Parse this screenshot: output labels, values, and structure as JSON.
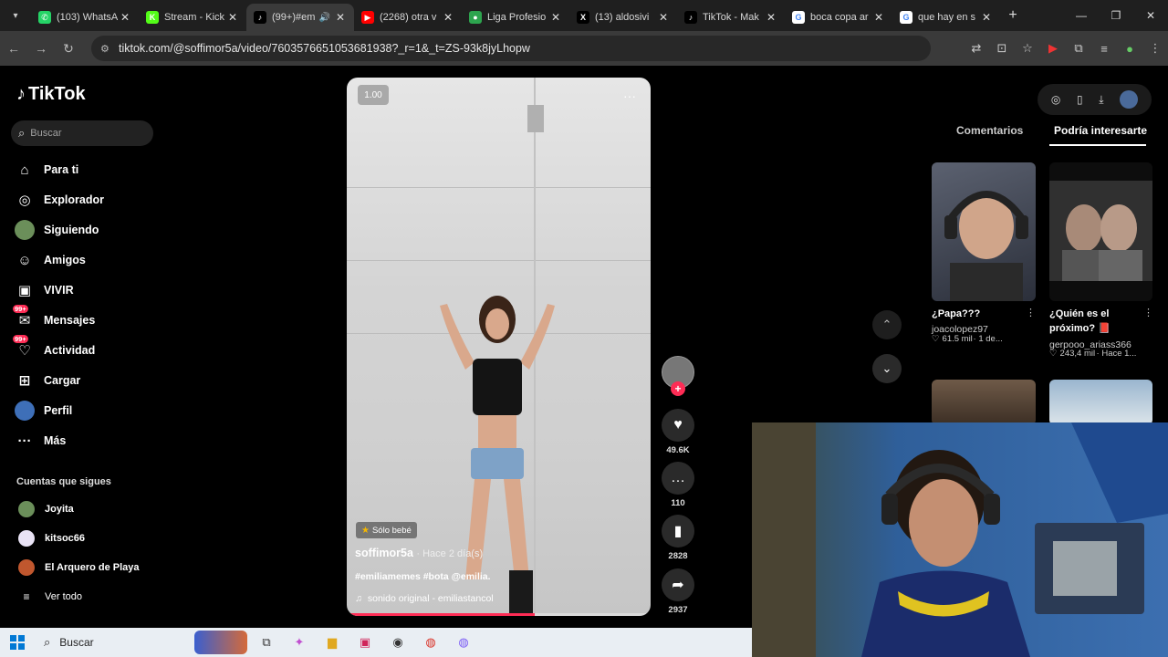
{
  "browser": {
    "tabs": [
      {
        "title": "(103) WhatsA",
        "icon": "whatsapp-icon",
        "color": "#25d366",
        "glyph": "✆",
        "active": false
      },
      {
        "title": "Stream - Kick",
        "icon": "kick-icon",
        "color": "#53fc18",
        "glyph": "K",
        "active": false
      },
      {
        "title": "(99+)#em",
        "icon": "tiktok-icon",
        "color": "#000000",
        "glyph": "♪",
        "active": true
      },
      {
        "title": "(2268) otra v",
        "icon": "youtube-icon",
        "color": "#ff0000",
        "glyph": "▶",
        "active": false
      },
      {
        "title": "Liga Profesio",
        "icon": "soccer-ball-icon",
        "color": "#2da44e",
        "glyph": "●",
        "active": false
      },
      {
        "title": "(13) aldosivi",
        "icon": "x-icon",
        "color": "#000000",
        "glyph": "X",
        "active": false
      },
      {
        "title": "TikTok - Mak",
        "icon": "tiktok-icon",
        "color": "#000000",
        "glyph": "♪",
        "active": false
      },
      {
        "title": "boca copa ar",
        "icon": "google-icon",
        "color": "#ffffff",
        "glyph": "G",
        "active": false
      },
      {
        "title": "que hay en s",
        "icon": "google-icon",
        "color": "#ffffff",
        "glyph": "G",
        "active": false
      }
    ],
    "url": "tiktok.com/@soffimor5a/video/7603576651053681938?_r=1&_t=ZS-93k8jyLhopw"
  },
  "tiktok": {
    "logo": "TikTok",
    "search_placeholder": "Buscar",
    "nav": [
      {
        "label": "Para ti",
        "icon": "home-icon",
        "glyph": "⌂"
      },
      {
        "label": "Explorador",
        "icon": "compass-icon",
        "glyph": "◎"
      },
      {
        "label": "Siguiendo",
        "icon": "following-avatar-icon",
        "glyph": ""
      },
      {
        "label": "Amigos",
        "icon": "friends-icon",
        "glyph": "☺"
      },
      {
        "label": "VIVIR",
        "icon": "live-icon",
        "glyph": "▣"
      },
      {
        "label": "Mensajes",
        "icon": "messages-icon",
        "glyph": "✉",
        "badge": "99+"
      },
      {
        "label": "Actividad",
        "icon": "activity-icon",
        "glyph": "♡",
        "badge": "99+"
      },
      {
        "label": "Cargar",
        "icon": "upload-icon",
        "glyph": "⊞"
      },
      {
        "label": "Perfil",
        "icon": "profile-avatar-icon",
        "glyph": ""
      },
      {
        "label": "Más",
        "icon": "more-dots-icon",
        "glyph": "···"
      }
    ],
    "following_title": "Cuentas que sigues",
    "following": [
      {
        "name": "Joyita",
        "color": "#6b8f5a"
      },
      {
        "name": "kitsoc66",
        "color": "#e9e3f5"
      },
      {
        "name": "El Arquero de Playa",
        "color": "#c0572e"
      }
    ],
    "see_all": "Ver todo",
    "video": {
      "volume_label": "1.00",
      "tag": "Sólo bebé",
      "author": "soffimor5a",
      "posted": "· Hace 2 día(s)",
      "description": "#emiliamemes #bota @emilia.",
      "sound": "sonido original - emiliastancol",
      "progress": 0.62
    },
    "actions": {
      "likes": "49.6K",
      "comments": "110",
      "saves": "2828",
      "shares": "2937"
    },
    "right_panel": {
      "tab_comments": "Comentarios",
      "tab_interest": "Podría interesarte",
      "recommendations": [
        {
          "title": "¿Papa???",
          "user": "joacolopez97",
          "likes": "61.5 mil",
          "time": "· 1 de..."
        },
        {
          "title": "¿Quién es el próximo? 📕",
          "user": "gerpooo_ariass366",
          "likes": "243,4 mil",
          "time": "· Hace 1..."
        }
      ]
    }
  },
  "taskbar": {
    "search_label": "Buscar"
  }
}
